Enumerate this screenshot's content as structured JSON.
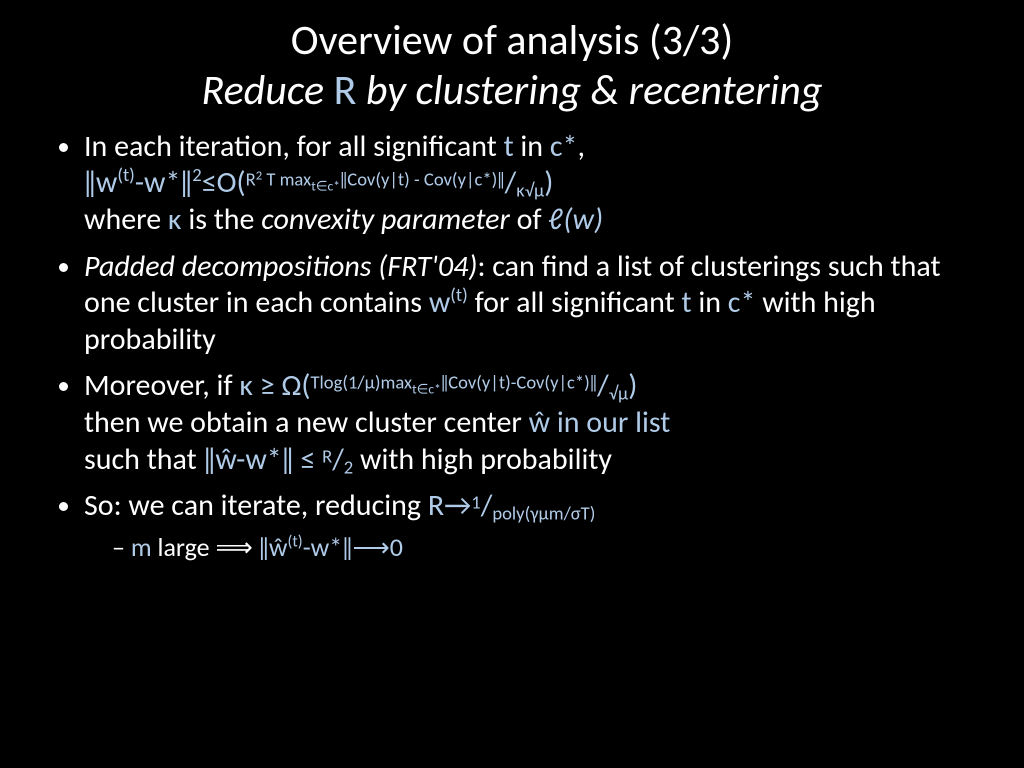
{
  "title": {
    "line1": "Overview of analysis (3/3)",
    "line2_pre": "Reduce ",
    "line2_R": "R",
    "line2_post": " by clustering & recentering"
  },
  "bullets": {
    "b1": {
      "a": "In each iteration, for all significant ",
      "t": "t",
      "b": " in ",
      "cstar": "c*",
      "comma": ",",
      "norm_open": "ǁ",
      "w_sup_t": "w",
      "sup_t": "(t)",
      "minus_wstar": "-w*",
      "norm_close": "ǁ",
      "sq": "2",
      "leqO": "≤O(",
      "exp_part": "R",
      "exp_2": "2",
      "exp_T": " T max",
      "exp_sub": "t∈c*",
      "exp_cov": "ǁCov(y|t) - Cov(y|c*)ǁ",
      "slash": "/",
      "den": "κ√μ",
      "close": ")",
      "where": "where ",
      "kappa": "κ",
      "is_the": " is the ",
      "convexity": "convexity parameter",
      "of": " of  ",
      "ell_w": "ℓ(w)"
    },
    "b2": {
      "padded": "Padded decompositions (FRT'04)",
      "colon": ": can find a list of clusterings such that one cluster in each contains ",
      "w": "w",
      "sup_t": "(t)",
      "for_all": " for all significant ",
      "t": "t",
      "in": " in ",
      "cstar": "c*",
      "tail": " with high probability"
    },
    "b3": {
      "a": "Moreover, if ",
      "kappa": "κ",
      "geq": " ≥ Ω(",
      "exp": "Tlog(1/μ)max",
      "exp_sub": "t∈c*",
      "exp_cov": "ǁCov(y|t)-Cov(y|c*)ǁ",
      "slash": "/",
      "den": "√μ",
      "close": ")",
      "then": "then we obtain a new cluster center ",
      "what": "ŵ",
      "inlist": " in our list",
      "such": "such that ",
      "norm": "ǁŵ-w*ǁ",
      "leq": " ≤ ",
      "num": "R",
      "slash2": "/",
      "den2": "2",
      "tail": " with high probability"
    },
    "b4": {
      "a": "So: we can iterate, reducing ",
      "R": "R",
      "arrow": "→",
      "num": "1",
      "slash": "/",
      "den": "poly(γμm/σT)"
    },
    "sub1": {
      "m": "m",
      "large": " large ",
      "imp": "⟹",
      "sp": " ",
      "norm_open": "ǁ",
      "what": "ŵ",
      "sup_t": "(t)",
      "minus": "-w*",
      "norm_close": "ǁ",
      "to0": "⟶0"
    }
  }
}
